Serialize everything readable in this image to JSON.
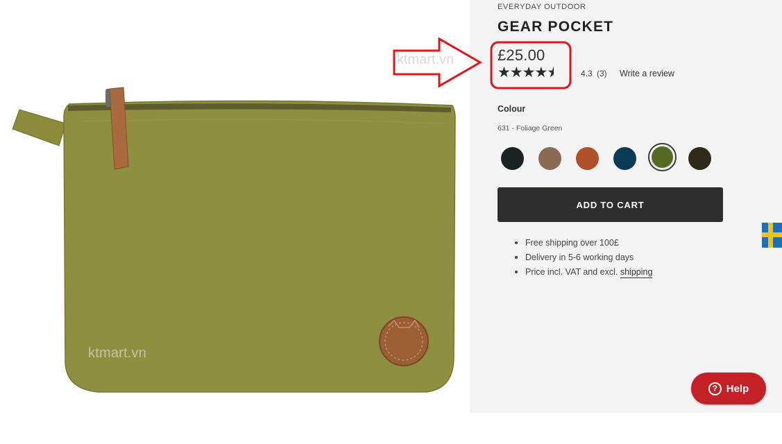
{
  "watermarks": {
    "image": "ktmart.vn",
    "arrow": "ktmart.vn"
  },
  "product": {
    "brand_line": "EVERYDAY OUTDOOR",
    "title": "GEAR POCKET",
    "price": "£25.00",
    "rating": {
      "value": 4.3,
      "value_text": "4.3",
      "count_text": "(3)",
      "stars": "★★★★",
      "half_star": "★",
      "write_review": "Write a review"
    },
    "colour": {
      "label": "Colour",
      "selected": "631 - Foliage Green",
      "swatches": [
        {
          "name": "black",
          "hex": "#1b2322"
        },
        {
          "name": "brown",
          "hex": "#8a6a52"
        },
        {
          "name": "autumn-orange",
          "hex": "#b0502a"
        },
        {
          "name": "navy",
          "hex": "#0a3a54"
        },
        {
          "name": "foliage-green",
          "hex": "#556b24",
          "selected": true
        },
        {
          "name": "dark-olive",
          "hex": "#2f2a1c"
        }
      ]
    },
    "add_to_cart": "ADD TO CART",
    "bullets": [
      "Free shipping over 100£",
      "Delivery in 5-6 working days",
      "Price incl. VAT and excl. "
    ],
    "shipping_link": "shipping"
  },
  "help_button": {
    "label": "Help",
    "icon": "?"
  },
  "flag": {
    "icon": "sweden-flag-icon"
  },
  "colors": {
    "panel_bg": "#f3f3f3",
    "cart_button": "#2e2e2e",
    "help_button": "#c42127",
    "annotation_red": "#e0151c"
  }
}
